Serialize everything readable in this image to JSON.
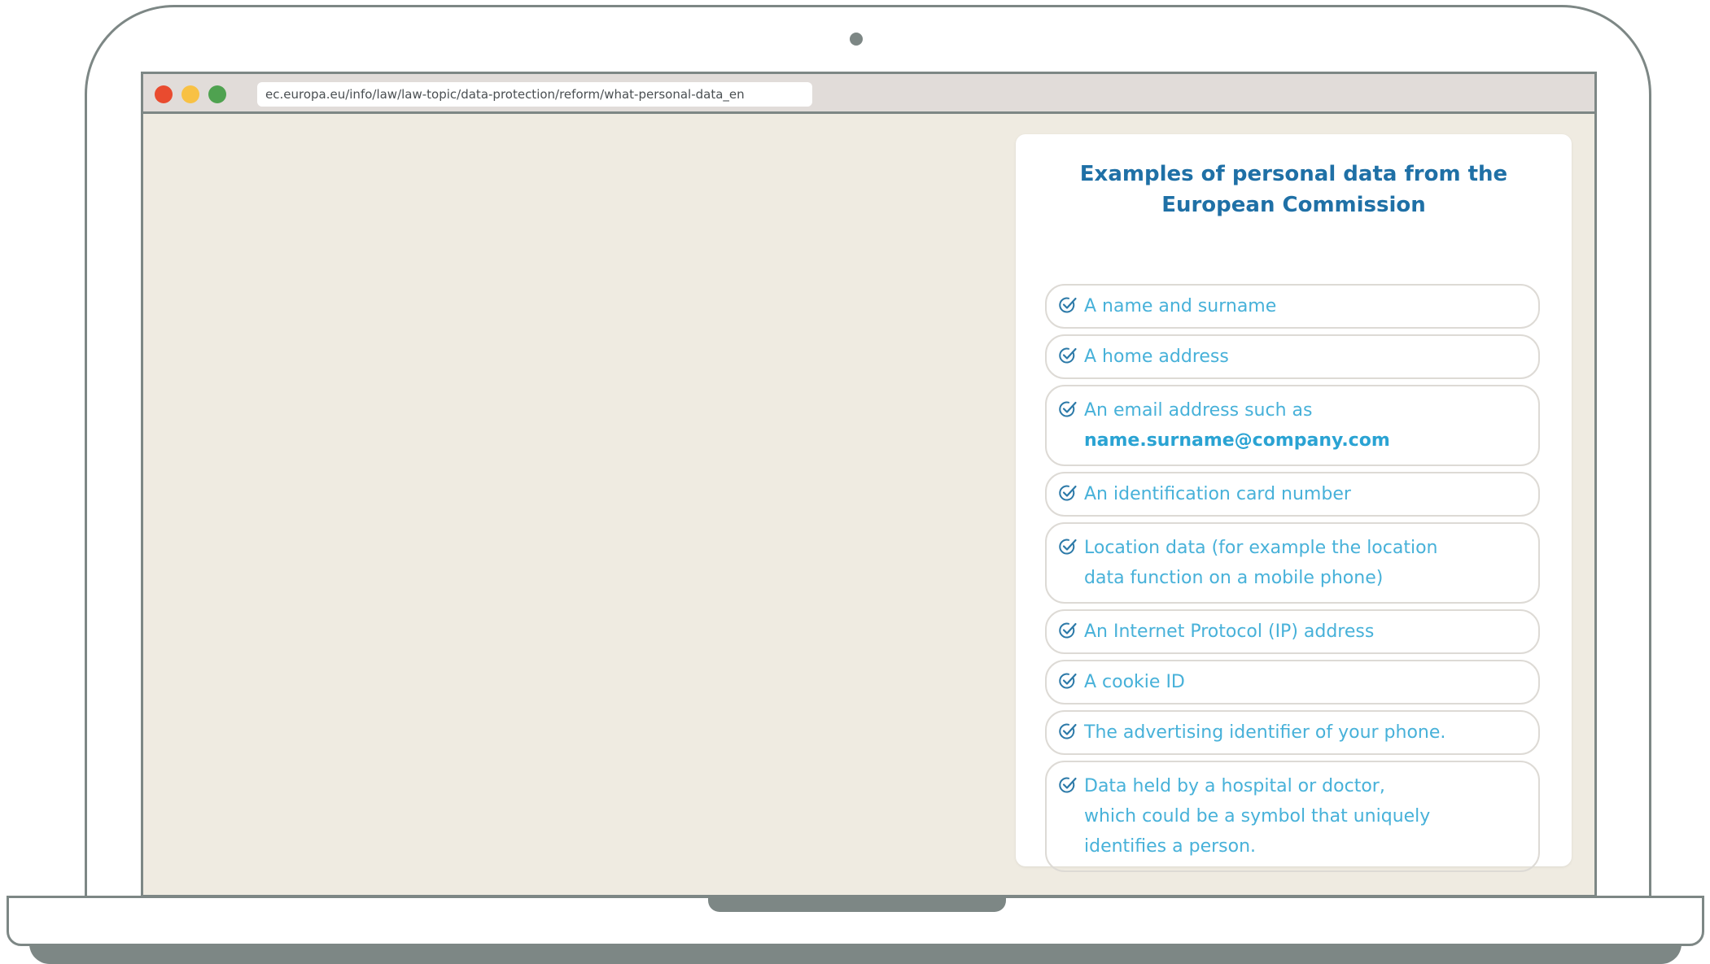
{
  "browser": {
    "url": "ec.europa.eu/info/law/law-topic/data-protection/reform/what-personal-data_en",
    "controls": [
      "close",
      "minimize",
      "maximize"
    ]
  },
  "card": {
    "title_line1": "Examples of personal data from the",
    "title_line2": "European Commission",
    "items": [
      {
        "text": "A name and surname"
      },
      {
        "text": "A home address"
      },
      {
        "text": "An email address such as",
        "text2": "name.surname@company.com"
      },
      {
        "text": "An identification card number"
      },
      {
        "text": "Location data (for example the location",
        "text2": "data function on a mobile phone)"
      },
      {
        "text": "An Internet Protocol (IP) address"
      },
      {
        "text": "A cookie ID"
      },
      {
        "text": "The advertising identifier of your phone."
      },
      {
        "text": "Data held by a hospital or doctor,",
        "text2": "which could be a symbol that uniquely",
        "text3": "identifies a person."
      }
    ]
  },
  "icons": {
    "item_check": "check-circle-icon",
    "camera": "camera-dot"
  },
  "colors": {
    "title": "#1f70a6",
    "item_text": "#47b1d9",
    "page_bg": "#efebe1",
    "frame": "#7d8785",
    "traffic_red": "#e94b2f",
    "traffic_yellow": "#f8c144",
    "traffic_green": "#4fa250"
  }
}
